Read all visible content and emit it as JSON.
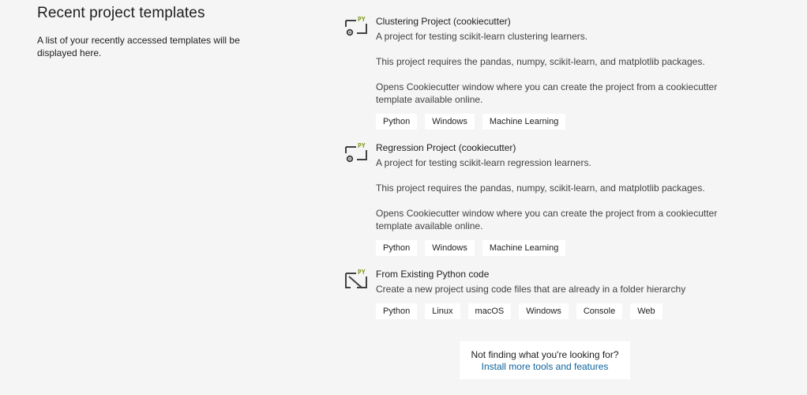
{
  "recent": {
    "title": "Recent project templates",
    "description": "A list of your recently accessed templates will be displayed here."
  },
  "templates": [
    {
      "icon": "python-project-gear-icon",
      "title": "Clustering Project (cookiecutter)",
      "summary": "A project for testing scikit-learn clustering learners.",
      "requirements": "This project requires the pandas, numpy, scikit-learn, and matplotlib packages.",
      "note": "Opens Cookiecutter window where you can create the project from a cookiecutter template available online.",
      "tags": [
        "Python",
        "Windows",
        "Machine Learning"
      ]
    },
    {
      "icon": "python-project-gear-icon",
      "title": "Regression Project (cookiecutter)",
      "summary": "A project for testing scikit-learn regression learners.",
      "requirements": "This project requires the pandas, numpy, scikit-learn, and matplotlib packages.",
      "note": "Opens Cookiecutter window where you can create the project from a cookiecutter template available online.",
      "tags": [
        "Python",
        "Windows",
        "Machine Learning"
      ]
    },
    {
      "icon": "python-existing-code-icon",
      "title": "From Existing Python code",
      "summary": "Create a new project using code files that are already in a folder hierarchy",
      "tags": [
        "Python",
        "Linux",
        "macOS",
        "Windows",
        "Console",
        "Web"
      ]
    }
  ],
  "not_found": {
    "question": "Not finding what you're looking for?",
    "link": "Install more tools and features"
  },
  "colors": {
    "background": "#f5f5f5",
    "tag_background": "#ffffff",
    "link": "#0e639c",
    "python_badge": "#7f9a1e"
  }
}
